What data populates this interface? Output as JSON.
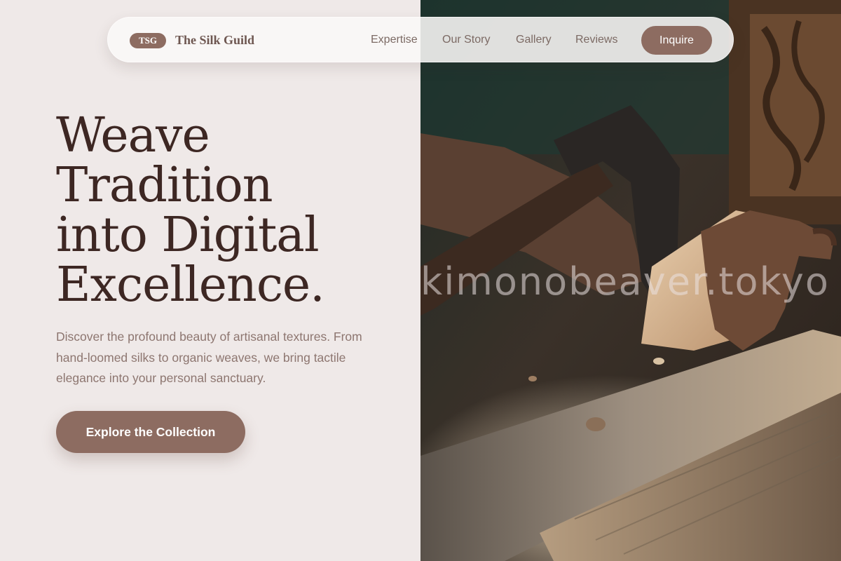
{
  "nav": {
    "badge": "TSG",
    "brand": "The Silk Guild",
    "links": [
      "Expertise",
      "Our Story",
      "Gallery",
      "Reviews"
    ],
    "cta": "Inquire"
  },
  "hero": {
    "title_lines": [
      "Weave",
      "Tradition",
      "into Digital",
      "Excellence."
    ],
    "subtitle": "Discover the profound beauty of artisanal textures. From hand-loomed silks to organic weaves, we bring tactile elegance into your personal sanctuary.",
    "cta": "Explore the Collection"
  },
  "photo": {
    "subject": "artisan carving wood with an adze",
    "watermark": "kimonobeaver.tokyo"
  },
  "colors": {
    "background": "#efe9e8",
    "accent": "#8d6c61",
    "heading": "#3d2723",
    "body_text": "#8d7670",
    "nav_text": "#7c6a64"
  }
}
